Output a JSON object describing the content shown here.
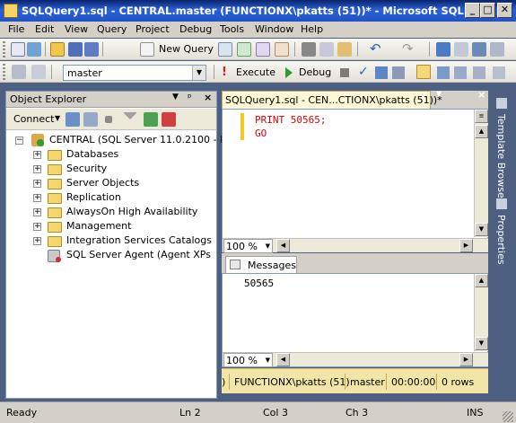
{
  "window": {
    "title": "SQLQuery1.sql - CENTRAL.master (FUNCTIONX\\pkatts (51))* - Microsoft SQL Server M...",
    "minimize": "_",
    "maximize": "□",
    "close": "✕"
  },
  "menu": [
    "File",
    "Edit",
    "View",
    "Query",
    "Project",
    "Debug",
    "Tools",
    "Window",
    "Help"
  ],
  "toolbar1": {
    "new_query_label": "New Query"
  },
  "toolbar2": {
    "database": "master",
    "execute_label": "Execute",
    "debug_label": "Debug"
  },
  "object_explorer": {
    "title": "Object Explorer",
    "pin": "ᵖ",
    "close": "×",
    "connect_label": "Connect",
    "server": "CENTRAL (SQL Server 11.0.2100 - FUN",
    "nodes": [
      "Databases",
      "Security",
      "Server Objects",
      "Replication",
      "AlwaysOn High Availability",
      "Management",
      "Integration Services Catalogs",
      "SQL Server Agent (Agent XPs disa"
    ]
  },
  "editor": {
    "tab_title": "SQLQuery1.sql - CEN...CTIONX\\pkatts (51))*",
    "tab_close": "×",
    "line1_keyword": "PRINT",
    "line1_value": "50565;",
    "line2_keyword": "GO",
    "zoom": "100 %"
  },
  "results": {
    "tab_label": "Messages",
    "output": "50565",
    "zoom": "100 %"
  },
  "query_status": {
    "user": "FUNCTIONX\\pkatts (51)",
    "database": "master",
    "elapsed": "00:00:00",
    "rows": "0 rows",
    "lead": ")"
  },
  "side_tabs": [
    "Template Browser",
    "Properties"
  ],
  "status": {
    "ready": "Ready",
    "line": "Ln 2",
    "col": "Col 3",
    "ch": "Ch 3",
    "mode": "INS"
  }
}
